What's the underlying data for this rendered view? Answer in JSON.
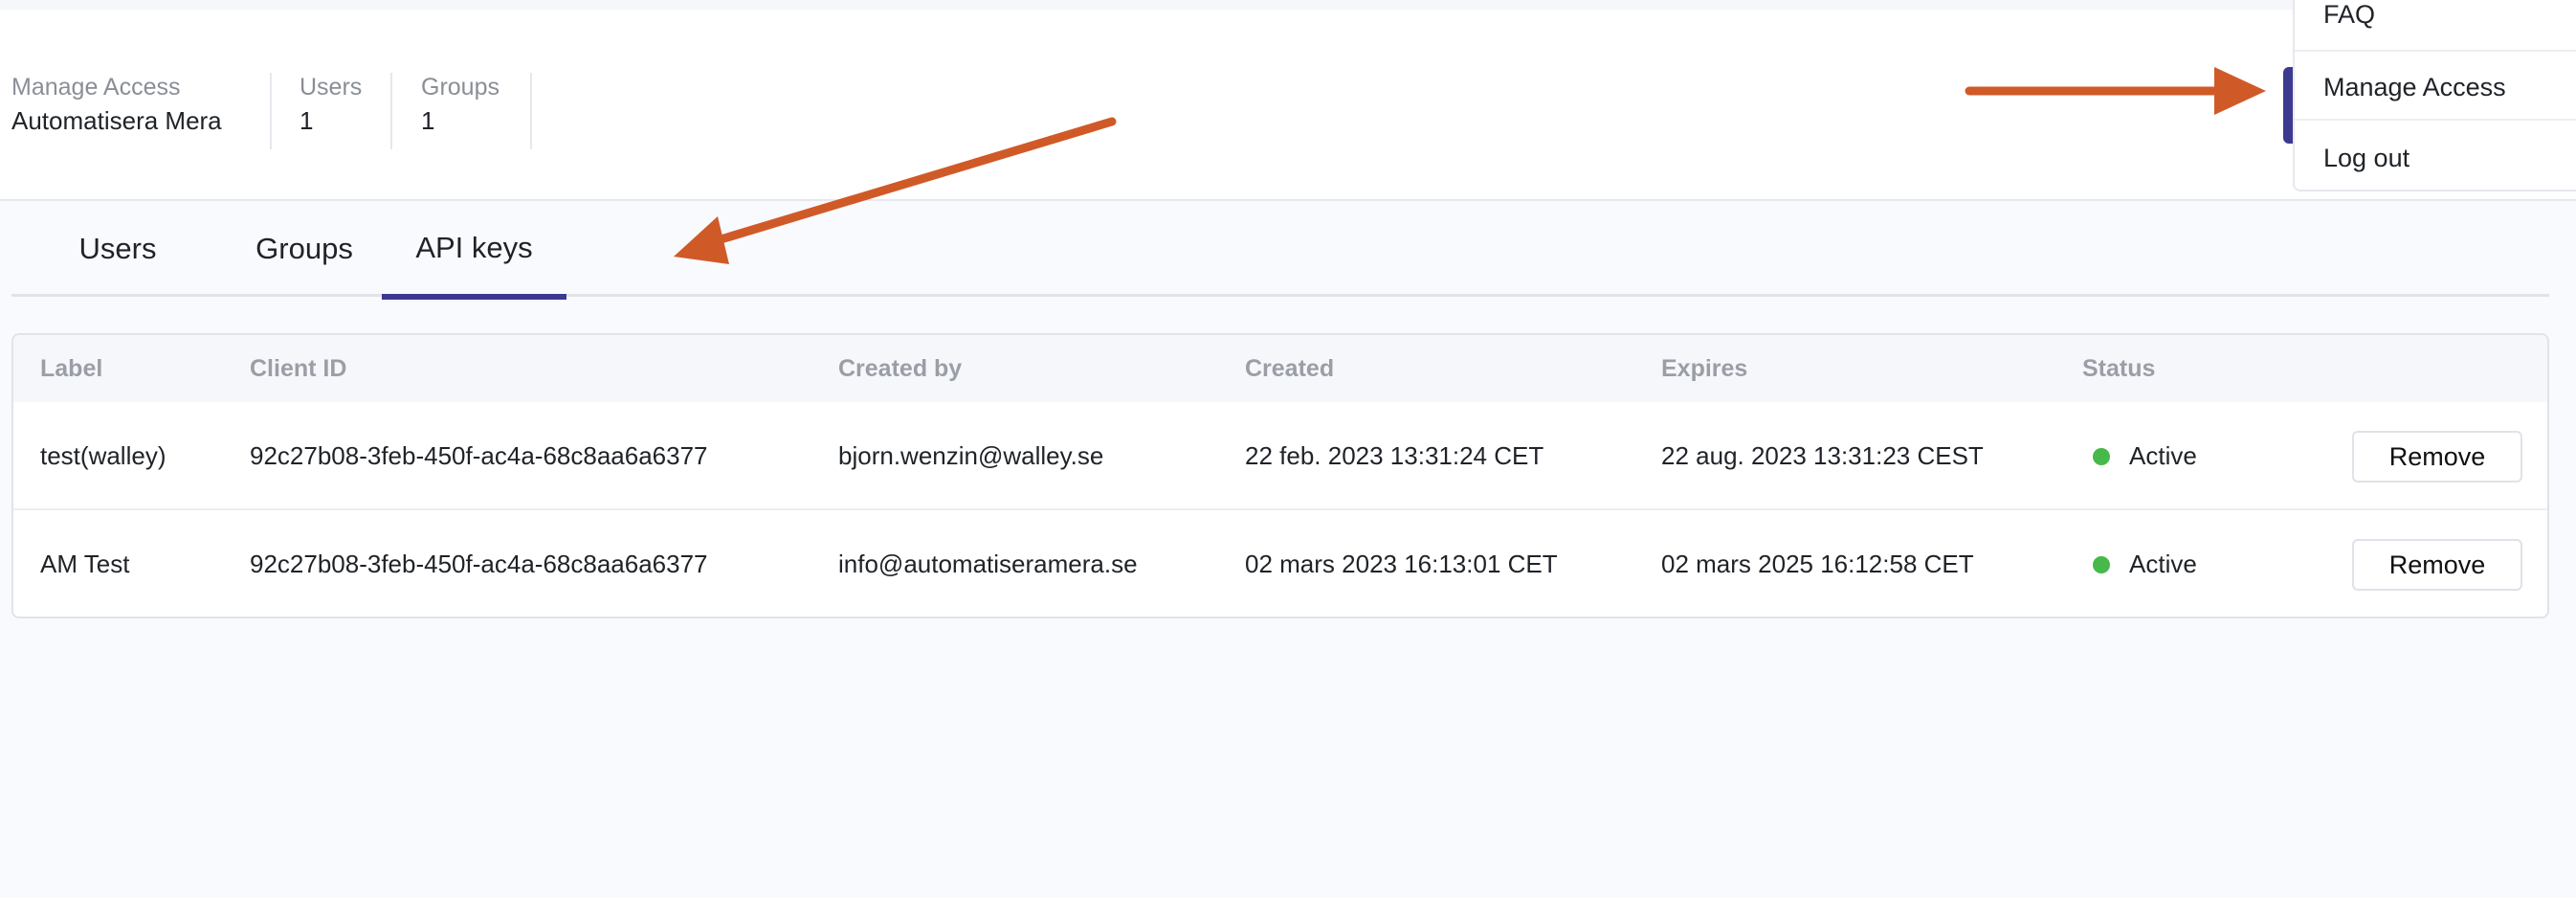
{
  "header": {
    "manage_access_label": "Manage Access",
    "org_name": "Automatisera Mera",
    "users_label": "Users",
    "users_count": "1",
    "groups_label": "Groups",
    "groups_count": "1"
  },
  "tabs": [
    {
      "label": "Users"
    },
    {
      "label": "Groups"
    },
    {
      "label": "API keys",
      "active": true
    }
  ],
  "table": {
    "columns": [
      "Label",
      "Client ID",
      "Created by",
      "Created",
      "Expires",
      "Status"
    ],
    "rows": [
      {
        "label": "test(walley)",
        "client_id": "92c27b08-3feb-450f-ac4a-68c8aa6a6377",
        "created_by": "bjorn.wenzin@walley.se",
        "created": "22 feb. 2023 13:31:24 CET",
        "expires": "22 aug. 2023 13:31:23 CEST",
        "status": "Active",
        "action": "Remove"
      },
      {
        "label": "AM Test",
        "client_id": "92c27b08-3feb-450f-ac4a-68c8aa6a6377",
        "created_by": "info@automatiseramera.se",
        "created": "02 mars 2023 16:13:01 CET",
        "expires": "02 mars 2025 16:12:58 CET",
        "status": "Active",
        "action": "Remove"
      }
    ]
  },
  "dropdown": {
    "items": [
      {
        "label": "FAQ"
      },
      {
        "label": "Manage Access"
      },
      {
        "label": "Log out"
      }
    ]
  },
  "colors": {
    "accent": "#3c3a8f",
    "status_active": "#47b84a",
    "annotation_arrow": "#d05a27"
  }
}
